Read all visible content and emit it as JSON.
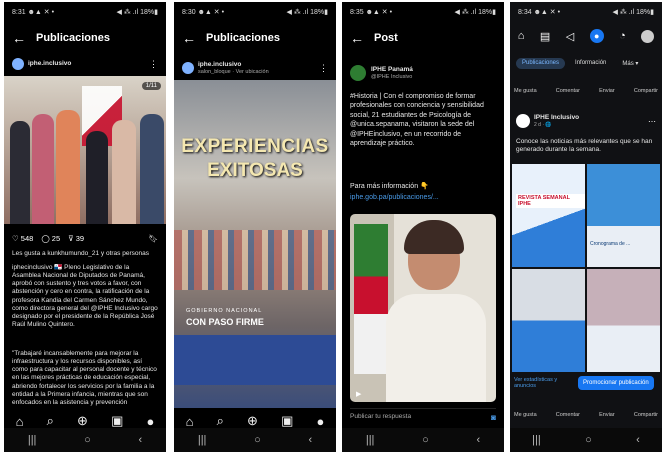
{
  "p1": {
    "status_time": "8:31 ☻▲ ✕ •",
    "status_icons": "◀ ⁂ .ıl 18%▮",
    "title": "Publicaciones",
    "account": "iphe.inclusivo",
    "counter": "1/11",
    "likes": "♡ 548",
    "comments": "◯ 25",
    "shares": "⊽ 39",
    "liked_by": "Les gusta a kunkhumundo_21 y otras personas",
    "caption_1": "iphecinclusivo 🇵🇦 Pleno Legislativo de la Asamblea Nacional de Diputados de Panamá, aprobó con sustento y tres votos a favor, con abstención y cero en contra, la ratificación de la profesora Kandia del Carmen Sánchez Mundo, como directora general del @IPHE Inclusivo cargo designado por el presidente de la República José Raúl Mulino Quintero.",
    "caption_2": "\"Trabajaré incansablemente para mejorar la infraestructura y los recursos disponibles, así como para capacitar al personal docente y técnico en las mejores prácticas de educación especial, abriendo fortalecer los servicios por la familia a la entidad a la Primera infancia, mientras que son enfocados en la asistencia y prevención"
  },
  "p2": {
    "status_time": "8:30 ☻▲ ✕ •",
    "status_icons": "◀ ⁂ .ıl 18%▮",
    "title": "Publicaciones",
    "account": "iphe.inclusivo",
    "sub_account": "salon_bloque · Ver ubicación",
    "overlay_line1": "EXPERIENCIAS",
    "overlay_line2": "EXITOSAS",
    "gov_label": "GOBIERNO NACIONAL",
    "gov_slogan": "CON PASO FIRME"
  },
  "p3": {
    "status_time": "8:35 ☻▲ ✕ •",
    "status_icons": "◀ ⁂ .ıl 18%▮",
    "title": "Post",
    "account_name": "IPHE Panamá",
    "account_handle": "@IPHE Inclusivo",
    "body": "#Historia | Con el compromiso de formar profesionales con conciencia y sensibilidad social, 21 estudiantes de Psicología de @unica.sepanama, visitaron la sede del @IPHEinclusivo, en un recorrido de aprendizaje práctico.",
    "more_info": "Para más información 👇",
    "url": "iphe.gob.pa/publicaciones/...",
    "reply_placeholder": "Publicar tu respuesta"
  },
  "p4": {
    "status_time": "8:34 ☻▲ ✕ •",
    "status_icons": "◀ ⁂ .ıl 18%▮",
    "tabs": [
      "Publicaciones",
      "Información",
      "Más ▾"
    ],
    "actions": [
      "Me gusta",
      "Comentar",
      "Enviar",
      "Compartir"
    ],
    "page_name": "IPHE Inclusivo",
    "post_meta": "2 d · 🌐",
    "post_text": "Conoce las noticias más relevantes que se han generado durante la semana.",
    "tile_1": "REVISTA SEMANAL IPHE",
    "tile_2": "Cronograma de ...",
    "see_stats": "Ver estadísticas y anuncios",
    "promote": "Promocionar publicación"
  }
}
